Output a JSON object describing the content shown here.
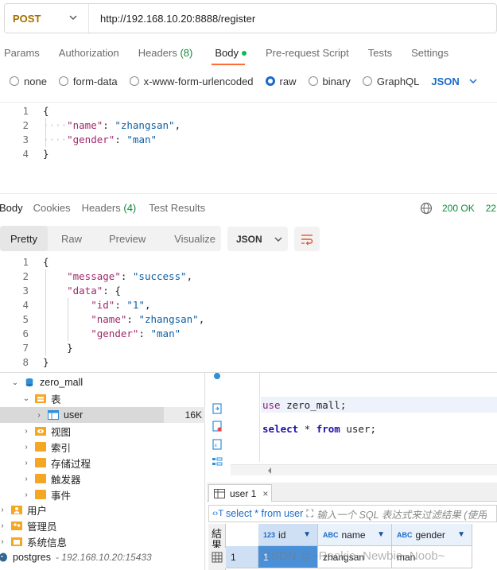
{
  "request": {
    "method": "POST",
    "url": "http://192.168.10.20:8888/register"
  },
  "request_tabs": [
    {
      "label": "Params"
    },
    {
      "label": "Authorization"
    },
    {
      "label": "Headers",
      "count": "(8)"
    },
    {
      "label": "Body"
    },
    {
      "label": "Pre-request Script"
    },
    {
      "label": "Tests"
    },
    {
      "label": "Settings"
    }
  ],
  "body_types": [
    "none",
    "form-data",
    "x-www-form-urlencoded",
    "raw",
    "binary",
    "GraphQL"
  ],
  "body_format": "JSON",
  "request_body": {
    "line_numbers": [
      "1",
      "2",
      "3",
      "4"
    ],
    "open": "{",
    "close": "}",
    "name_key": "\"name\"",
    "name_val": "\"zhangsan\"",
    "gender_key": "\"gender\"",
    "gender_val": "\"man\""
  },
  "response_tabs": [
    {
      "label": "Body"
    },
    {
      "label": "Cookies"
    },
    {
      "label": "Headers",
      "count": "(4)"
    },
    {
      "label": "Test Results"
    }
  ],
  "response_status": {
    "code": "200 OK",
    "time": "22"
  },
  "view_tabs": [
    "Pretty",
    "Raw",
    "Preview",
    "Visualize"
  ],
  "response_format": "JSON",
  "response_body": {
    "line_numbers": [
      "1",
      "2",
      "3",
      "4",
      "5",
      "6",
      "7",
      "8"
    ],
    "open": "{",
    "close": "}",
    "message_key": "\"message\"",
    "message_val": "\"success\"",
    "data_key": "\"data\"",
    "data_open": "{",
    "data_close": "}",
    "id_key": "\"id\"",
    "id_val": "\"1\"",
    "name_key": "\"name\"",
    "name_val": "\"zhangsan\"",
    "gender_key": "\"gender\"",
    "gender_val": "\"man\""
  },
  "tree": {
    "database": "zero_mall",
    "tables_group": "表",
    "table": "user",
    "table_size": "16K",
    "views": "视图",
    "indexes": "索引",
    "procedures": "存储过程",
    "triggers": "触发器",
    "events": "事件",
    "users": "用户",
    "admins": "管理员",
    "sysinfo": "系统信息",
    "pg_name": "postgres",
    "pg_host": "- 192.168.10.20:15433"
  },
  "sql": {
    "use_kw": "use",
    "use_rest": " zero_mall;",
    "select_kw": "select",
    "star": " * ",
    "from_kw": "from",
    "table": " user;"
  },
  "result": {
    "tab_label": "user 1",
    "filter_query": "select * from user",
    "filter_placeholder": "输入一个 SQL 表达式来过滤结果 (使用",
    "side_label": "結果",
    "columns": [
      {
        "type": "123",
        "name": "id"
      },
      {
        "type": "ABC",
        "name": "name"
      },
      {
        "type": "ABC",
        "name": "gender"
      }
    ],
    "row": {
      "index": "1",
      "id": "1",
      "name": "zhangsan",
      "gender": "man"
    }
  },
  "watermark": "CSDN @~Rookie~Newbie~Noob~",
  "colors": {
    "accent": "#1b6ac9",
    "post": "#a86e00",
    "ok": "#0f8a3c",
    "folder": "#f5a623"
  }
}
